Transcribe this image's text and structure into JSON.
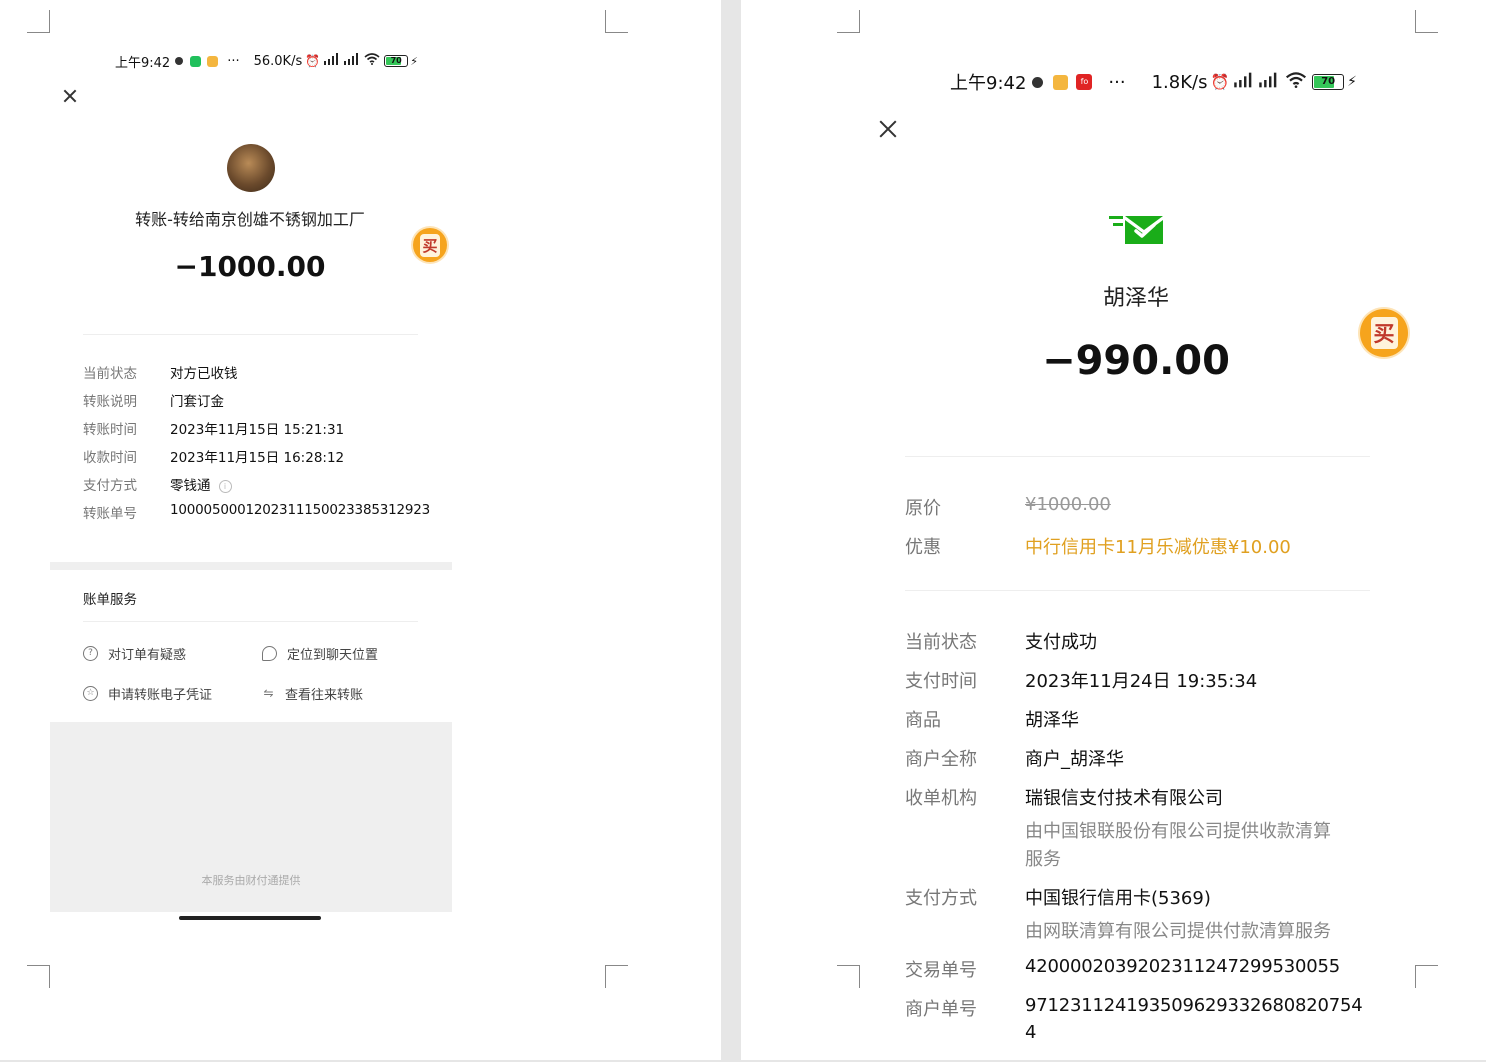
{
  "left": {
    "status_bar": {
      "time": "上午9:42",
      "more": "···",
      "speed": "56.0K/s",
      "battery": "70"
    },
    "title": "转账-转给南京创雄不锈钢加工厂",
    "amount": "−1000.00",
    "buy_badge": "买",
    "details": [
      {
        "label": "当前状态",
        "value": "对方已收钱"
      },
      {
        "label": "转账说明",
        "value": "门套订金"
      },
      {
        "label": "转账时间",
        "value": "2023年11月15日 15:21:31"
      },
      {
        "label": "收款时间",
        "value": "2023年11月15日 16:28:12"
      },
      {
        "label": "支付方式",
        "value": "零钱通"
      },
      {
        "label": "转账单号",
        "value": "1000050001202311150023385312923"
      }
    ],
    "services": {
      "title": "账单服务",
      "items": [
        {
          "label": "对订单有疑惑",
          "icon": "question-icon"
        },
        {
          "label": "定位到聊天位置",
          "icon": "chat-bubble-icon"
        },
        {
          "label": "申请转账电子凭证",
          "icon": "star-badge-icon"
        },
        {
          "label": "查看往来转账",
          "icon": "swap-arrows-icon"
        }
      ]
    },
    "footer": "本服务由财付通提供",
    "colors": {
      "gray_band": "#efefef",
      "label": "#777777"
    }
  },
  "right": {
    "status_bar": {
      "time": "上午9:42",
      "more": "···",
      "speed": "1.8K/s",
      "battery": "70",
      "app_badge": "fo"
    },
    "merchant": "胡泽华",
    "amount": "−990.00",
    "buy_badge": "买",
    "pricing": [
      {
        "label": "原价",
        "value": "¥1000.00",
        "style": "strike"
      },
      {
        "label": "优惠",
        "value": "中行信用卡11月乐减优惠¥10.00",
        "style": "orange"
      }
    ],
    "details": [
      {
        "label": "当前状态",
        "value": "支付成功"
      },
      {
        "label": "支付时间",
        "value": "2023年11月24日 19:35:34"
      },
      {
        "label": "商品",
        "value": "胡泽华"
      },
      {
        "label": "商户全称",
        "value": "商户_胡泽华"
      },
      {
        "label": "收单机构",
        "value": "瑞银信支付技术有限公司",
        "sub1": "由中国银联股份有限公司提供收款清算",
        "sub2": "服务"
      },
      {
        "label": "支付方式",
        "value": "中国银行信用卡(5369)",
        "sub1": "由网联清算有限公司提供付款清算服务"
      },
      {
        "label": "交易单号",
        "value": "4200002039202311247299530055"
      },
      {
        "label": "商户单号",
        "value": "971231124193509629332680820754",
        "value2": "4"
      }
    ],
    "colors": {
      "orange": "#e0a020",
      "wechat_green": "#1aad19"
    }
  }
}
